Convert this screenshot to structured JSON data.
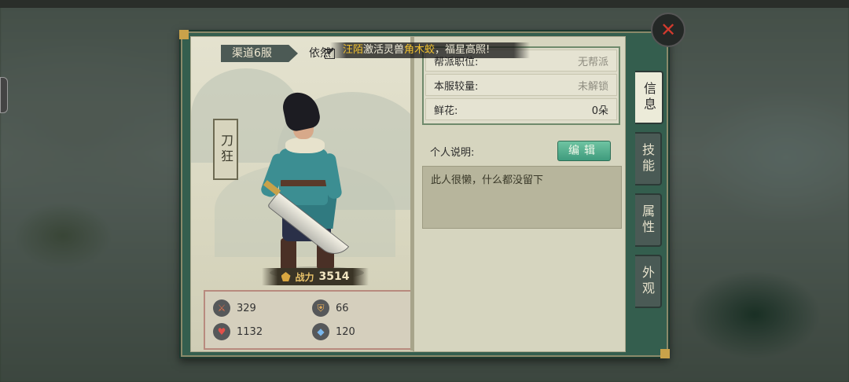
{
  "header": {
    "server": "渠道6服",
    "player_name": "依然"
  },
  "announcement": {
    "player": "汪陌",
    "action": "激活灵兽",
    "beast": "角木蛟",
    "suffix": "，福星高照!"
  },
  "character": {
    "class_name": "刀狂",
    "power_label": "战力",
    "power_value": "3514"
  },
  "stats": [
    {
      "icon": "attack-icon",
      "value": "329"
    },
    {
      "icon": "defense-icon",
      "value": "66"
    },
    {
      "icon": "health-icon",
      "value": "1132"
    },
    {
      "icon": "mana-icon",
      "value": "120"
    }
  ],
  "info": {
    "guild_label": "帮派职位:",
    "guild_value": "无帮派",
    "rank_label": "本服较量:",
    "rank_value": "未解锁",
    "flowers_label": "鲜花:",
    "flowers_value": "0朵"
  },
  "description": {
    "label": "个人说明:",
    "edit_button": "编辑",
    "text": "此人很懒，什么都没留下"
  },
  "tabs": [
    {
      "label": "信息",
      "active": true
    },
    {
      "label": "技能",
      "active": false
    },
    {
      "label": "属性",
      "active": false
    },
    {
      "label": "外观",
      "active": false
    }
  ],
  "close_icon": "close-icon",
  "colors": {
    "frame": "#345e4e",
    "accent_green": "#4fae8a",
    "highlight_yellow": "#f2c230"
  }
}
